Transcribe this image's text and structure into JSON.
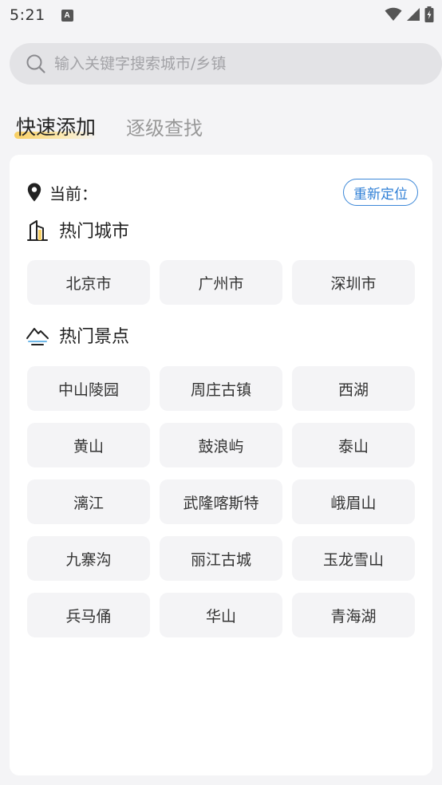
{
  "status_bar": {
    "time": "5:21",
    "notification_badge": "A"
  },
  "search": {
    "placeholder": "输入关键字搜索城市/乡镇"
  },
  "tabs": [
    {
      "label": "快速添加",
      "active": true
    },
    {
      "label": "逐级查找",
      "active": false
    }
  ],
  "current": {
    "label": "当前：",
    "relocate_label": "重新定位"
  },
  "hot_cities": {
    "title": "热门城市",
    "items": [
      "北京市",
      "广州市",
      "深圳市"
    ]
  },
  "hot_spots": {
    "title": "热门景点",
    "items": [
      "中山陵园",
      "周庄古镇",
      "西湖",
      "黄山",
      "鼓浪屿",
      "泰山",
      "漓江",
      "武隆喀斯特",
      "峨眉山",
      "九寨沟",
      "丽江古城",
      "玉龙雪山",
      "兵马俑",
      "华山",
      "青海湖"
    ]
  },
  "colors": {
    "accent_blue": "#2f7fd6",
    "tab_highlight": "#f8cf63",
    "chip_bg": "#f4f4f6",
    "page_bg": "#f4f4f6"
  }
}
